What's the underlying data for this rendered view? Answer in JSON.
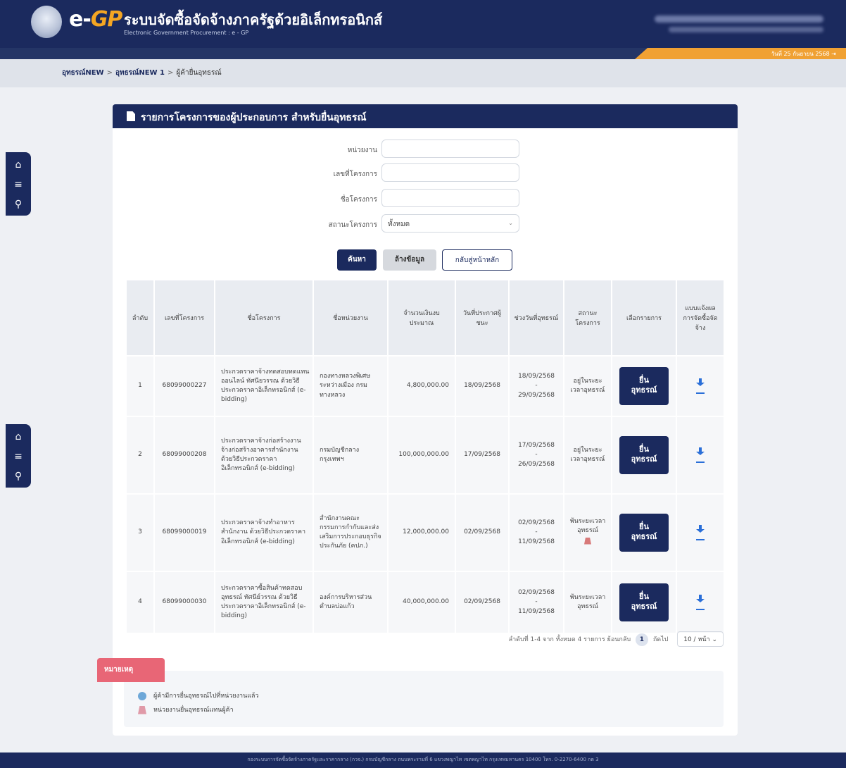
{
  "header": {
    "logo_text_e": "e-",
    "logo_text_gp": "GP",
    "system_title": "ระบบจัดซื้อจัดจ้างภาครัฐด้วยอิเล็กทรอนิกส์",
    "system_subtitle": "Electronic Government Procurement : e - GP",
    "date_text": "วันที่ 25 กันยายน 2568"
  },
  "breadcrumb": {
    "items": [
      "อุทธรณ์NEW",
      "อุทธรณ์NEW 1",
      "ผู้ค้ายื่นอุทธรณ์"
    ]
  },
  "card": {
    "title": "รายการโครงการของผู้ประกอบการ สำหรับยื่นอุทธรณ์"
  },
  "form": {
    "agency_label": "หน่วยงาน",
    "project_no_label": "เลขที่โครงการ",
    "project_name_label": "ชื่อโครงการ",
    "status_label": "สถานะโครงการ",
    "status_value": "ทั้งหมด",
    "search_label": "ค้นหา",
    "clear_label": "ล้างข้อมูล",
    "back_label": "กลับสู่หน้าหลัก"
  },
  "table": {
    "headers": [
      "ลำดับ",
      "เลขที่โครงการ",
      "ชื่อโครงการ",
      "ชื่อหน่วยงาน",
      "จำนวนเงินงบประมาณ",
      "วันที่ประกาศผู้ชนะ",
      "ช่วงวันที่อุทธรณ์",
      "สถานะโครงการ",
      "เลือกรายการ",
      "แบบแจ้งผลการจัดซื้อจัดจ้าง"
    ],
    "submit_label_line1": "ยื่น",
    "submit_label_line2": "อุทธรณ์",
    "rows": [
      {
        "no": "1",
        "project_no": "68099000227",
        "name": "ประกวดราคาจ้างทดสอบทดแทนออนไลน์ ทัศนียวรรณ ด้วยวิธีประกวดราคาอิเล็กทรอนิกส์ (e-bidding)",
        "agency": "กองทางหลวงพิเศษระหว่างเมือง กรมทางหลวง",
        "budget": "4,800,000.00",
        "announce_date": "18/09/2568",
        "appeal_start": "18/09/2568",
        "appeal_sep": "-",
        "appeal_end": "29/09/2568",
        "status": "อยู่ในระยะเวลาอุทธรณ์"
      },
      {
        "no": "2",
        "project_no": "68099000208",
        "name": "ประกวดราคาจ้างก่อสร้างงานจ้างก่อสร้างอาคารสำนักงาน ด้วยวิธีประกวดราคาอิเล็กทรอนิกส์ (e-bidding)",
        "agency": "กรมบัญชีกลาง กรุงเทพฯ",
        "budget": "100,000,000.00",
        "announce_date": "17/09/2568",
        "appeal_start": "17/09/2568",
        "appeal_sep": "-",
        "appeal_end": "26/09/2568",
        "status": "อยู่ในระยะเวลาอุทธรณ์"
      },
      {
        "no": "3",
        "project_no": "68099000019",
        "name": "ประกวดราคาจ้างทำอาหารสำนักงาน ด้วยวิธีประกวดราคาอิเล็กทรอนิกส์ (e-bidding)",
        "agency": "สำนักงานคณะกรรมการกำกับและส่งเสริมการประกอบธุรกิจประกันภัย (คปภ.)",
        "budget": "12,000,000.00",
        "announce_date": "02/09/2568",
        "appeal_start": "02/09/2568",
        "appeal_sep": "-",
        "appeal_end": "11/09/2568",
        "status": "พ้นระยะเวลาอุทธรณ์"
      },
      {
        "no": "4",
        "project_no": "68099000030",
        "name": "ประกวดราคาซื้อสินค้าทดสอบอุทธรณ์ ทัศนีย์วรรณ ด้วยวิธีประกวดราคาอิเล็กทรอนิกส์ (e-bidding)",
        "agency": "องค์การบริหารส่วนตำบลบ่อแก้ว",
        "budget": "40,000,000.00",
        "announce_date": "02/09/2568",
        "appeal_start": "02/09/2568",
        "appeal_sep": "-",
        "appeal_end": "11/09/2568",
        "status": "พ้นระยะเวลาอุทธรณ์"
      }
    ]
  },
  "pager": {
    "summary": "ลำดับที่ 1-4 จาก ทั้งหมด 4 รายการ ย้อนกลับ",
    "current_page": "1",
    "next_label": "ถัดไป",
    "page_size": "10 / หน้า"
  },
  "note": {
    "tab_label": "หมายเหตุ",
    "line1": "ผู้ค้ามีการยื่นอุทธรณ์ไปที่หน่วยงานแล้ว",
    "line2": "หน่วยงานยื่นอุทธรณ์แทนผู้ค้า"
  },
  "footer": {
    "text": "กองระบบการจัดซื้อจัดจ้างภาครัฐและราคากลาง (กวจ.) กรมบัญชีกลาง ถนนพระรามที่ 6 แขวงพญาไท เขตพญาไท กรุงเทพมหานคร 10400 โทร. 0-2270-6400 กด 3"
  },
  "colors": {
    "navy": "#1b2a5e",
    "orange": "#f0a133",
    "note_red": "#e86676",
    "download_blue": "#2a6fd8"
  }
}
